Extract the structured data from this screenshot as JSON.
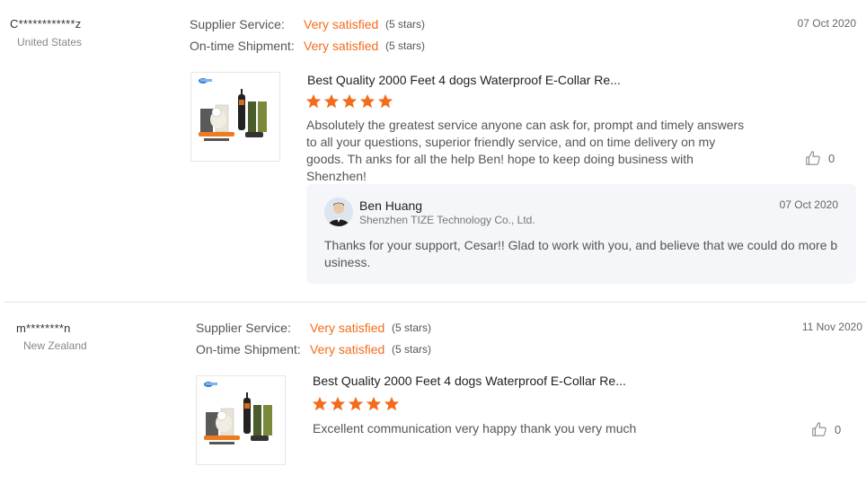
{
  "reviews": [
    {
      "user": "C************z",
      "country": "United States",
      "date": "07 Oct 2020",
      "supplier_service_label": "Supplier Service:",
      "supplier_service_value": "Very satisfied",
      "supplier_service_stars": "(5 stars)",
      "shipment_label": "On-time Shipment:",
      "shipment_value": "Very satisfied",
      "shipment_stars": "(5 stars)",
      "product_title": "Best Quality 2000 Feet 4 dogs Waterproof E-Collar Re...",
      "rating": 5,
      "comment": "Absolutely the greatest service anyone can ask for, prompt and timely answers to all your questions, superior friendly service, and on time delivery on my goods. Th anks for all the help Ben! hope to keep doing business with Shenzhen!",
      "likes": "0",
      "reply": {
        "name": "Ben Huang",
        "company": "Shenzhen TIZE Technology Co., Ltd.",
        "date": "07 Oct 2020",
        "text": "Thanks for your support, Cesar!! Glad to work with you, and believe that we could do more business."
      }
    },
    {
      "user": "m********n",
      "country": "New Zealand",
      "date": "11 Nov 2020",
      "supplier_service_label": "Supplier Service:",
      "supplier_service_value": "Very satisfied",
      "supplier_service_stars": "(5 stars)",
      "shipment_label": "On-time Shipment:",
      "shipment_value": "Very satisfied",
      "shipment_stars": "(5 stars)",
      "product_title": "Best Quality 2000 Feet 4 dogs Waterproof E-Collar Re...",
      "rating": 5,
      "comment": "Excellent communication very happy thank you very much",
      "likes": "0"
    }
  ],
  "colors": {
    "accent": "#f36c1c",
    "divider": "#e3e3e3",
    "reply_bg": "#f4f6f9"
  },
  "icons": {
    "star": "star-icon",
    "like": "thumbs-up-icon"
  }
}
